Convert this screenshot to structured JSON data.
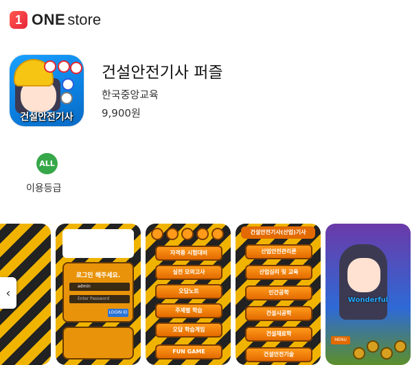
{
  "header": {
    "logo_badge": "1",
    "logo_one": "ONE",
    "logo_store": "store"
  },
  "app": {
    "title": "건설안전기사 퍼즐",
    "developer": "한국중앙교육",
    "price": "9,900원",
    "icon_caption": "건설안전기사"
  },
  "rating": {
    "badge": "ALL",
    "label": "이용등급"
  },
  "screenshots": {
    "prev_icon": "chevron-left-icon",
    "login": {
      "title": "로그인 해주세요.",
      "id_value": "admin",
      "password_placeholder": "Enter Password",
      "login_button": "LOGIN ID"
    },
    "menu": [
      "자격증 시험대비",
      "실전 모의고사",
      "오답노트",
      "주제별 학습",
      "오답 학습게임",
      "FUN GAME"
    ],
    "subjects_title": "건설안전기사(산업)기사",
    "subjects": [
      "산업안전관리론",
      "산업심리 및 교육",
      "인간공학",
      "건설시공학",
      "건설재료학",
      "건설안전기술"
    ],
    "game_word": "Wonderful",
    "game_menu": "MENU"
  }
}
